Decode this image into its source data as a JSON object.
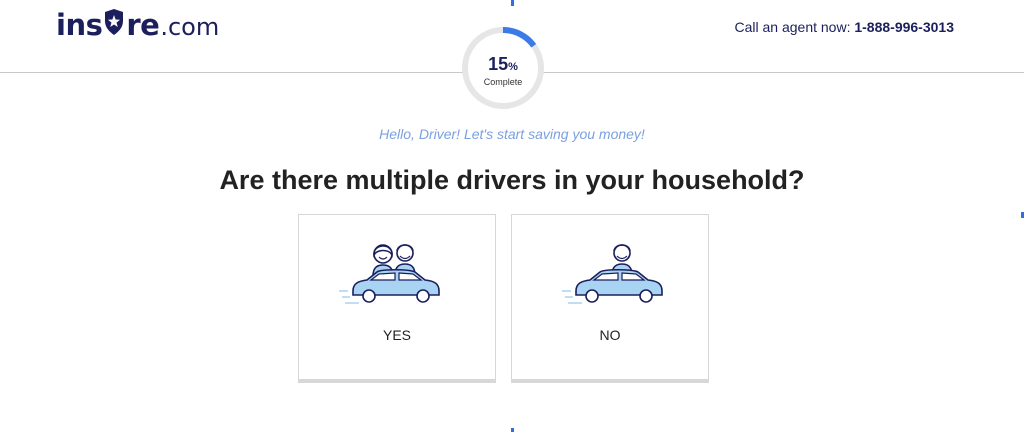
{
  "header": {
    "logo_brand_part1": "ins",
    "logo_brand_part2": "re",
    "logo_tld": ".com",
    "agent_prefix": "Call an agent now: ",
    "agent_phone": "1-888-996-3013"
  },
  "progress": {
    "percent_number": "15",
    "percent_sign": "%",
    "label": "Complete",
    "fraction": 0.15
  },
  "greeting": "Hello, Driver! Let's start saving you money!",
  "question": "Are there multiple drivers in your household?",
  "options": [
    {
      "label": "YES",
      "icon": "two-drivers-car-icon"
    },
    {
      "label": "NO",
      "icon": "one-driver-car-icon"
    }
  ],
  "colors": {
    "brand_navy": "#1b1f5c",
    "accent_blue": "#3b7be8",
    "greeting_blue": "#7aa0e0",
    "illustration_fill": "#a9d3f2"
  }
}
